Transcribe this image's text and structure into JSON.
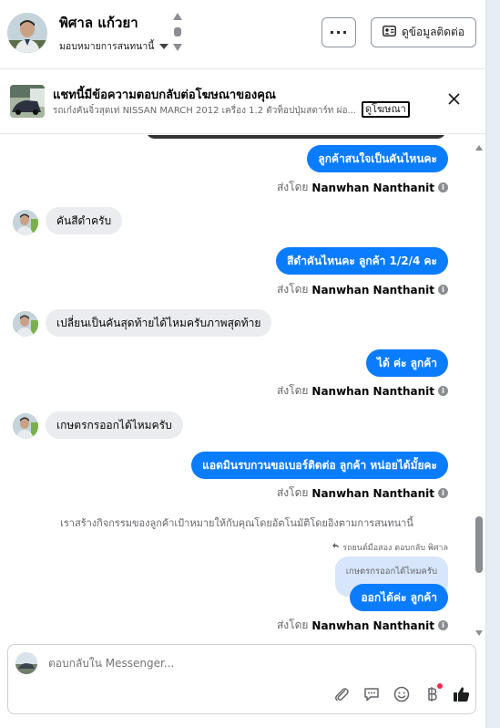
{
  "header": {
    "name": "พิศาล แก้วยา",
    "assign_label": "มอบหมายการสนทนานี้",
    "more_label": "···",
    "contact_label": "ดูข้อมูลติดต่อ"
  },
  "ad_banner": {
    "title": "แชทนี้มีข้อความตอบกลับต่อโฆษณาของคุณ",
    "subtitle": "รถเก๋งคันจิ๋วสุดเท่ NISSAN MARCH 2012 เครื่อง 1.2 ตัวท็อปปุ่มสตาร์ท ผ่อ...",
    "link_label": "ดูโฆษณา"
  },
  "messages": [
    {
      "id": "m1",
      "text": "ลูกค้าสนใจเป็นคันไหนคะ"
    },
    {
      "id": "m2",
      "text": "คันสีดำครับ"
    },
    {
      "id": "m3",
      "text": "สีดำคันไหนคะ ลูกค้า 1/2/4 คะ"
    },
    {
      "id": "m4",
      "text": "เปลี่ยนเป็นคันสุดท้ายได้ไหมครับภาพสุดท้าย"
    },
    {
      "id": "m5",
      "text": "ได้ ค่ะ  ลูกค้า"
    },
    {
      "id": "m6",
      "text": "เกษตรกรออกได้ไหมครับ"
    },
    {
      "id": "m7",
      "text": "แอดมินรบกวนขอเบอร์ติดต่อ ลูกค้า หน่อยได้มั้ยคะ"
    },
    {
      "id": "m8",
      "text": "ออกได้ค่ะ  ลูกค้า"
    }
  ],
  "sent_by": {
    "prefix": "ส่งโดย",
    "name": "Nanwhan Nanthanit"
  },
  "system_message": "เราสร้างกิจกรรมของลูกค้าเป้าหมายให้กับคุณโดยอัตโนมัติโดยอิงตามการสนทนานี้",
  "reply_label": "รถยนต์มือสอง ตอบกลับ พิศาล",
  "reply_quote": "เกษตรกรออกได้ไหมครับ",
  "composer": {
    "placeholder": "ตอบกลับใน Messenger..."
  },
  "icons": [
    "chevron-updown-icon",
    "contact-card-icon",
    "close-icon",
    "info-icon",
    "reply-arrow-icon",
    "scroll-up-icon",
    "scroll-down-icon",
    "attach-icon",
    "saved-reply-icon",
    "emoji-icon",
    "payment-icon",
    "like-icon"
  ],
  "colors": {
    "outgoing_bubble": "#0a7cff",
    "incoming_bubble": "#eaecef",
    "reply_quote_bg": "#d7e6fb",
    "notification_dot": "#f02849"
  }
}
